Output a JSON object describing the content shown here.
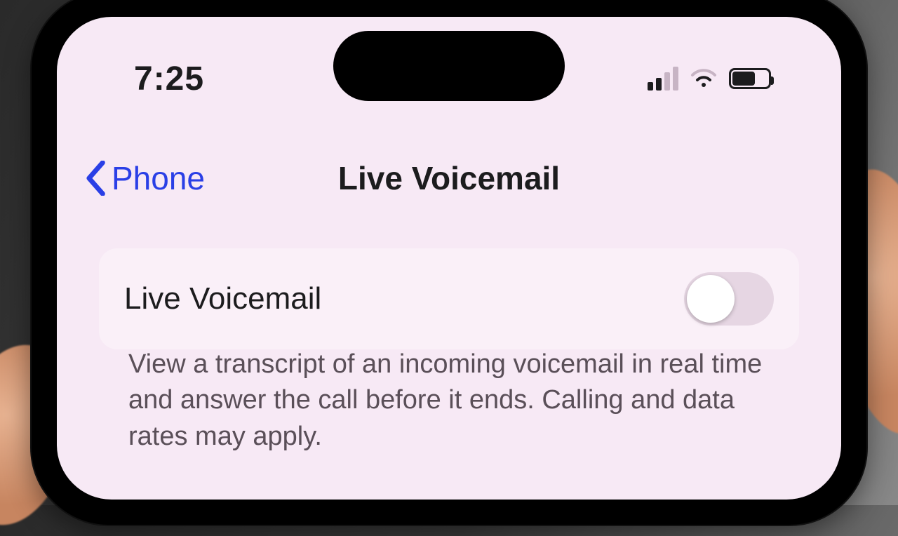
{
  "status": {
    "time": "7:25",
    "cell_bars_active": 2,
    "cell_bars_total": 4
  },
  "nav": {
    "back_label": "Phone",
    "title": "Live Voicemail"
  },
  "setting": {
    "label": "Live Voicemail",
    "enabled": false
  },
  "footer": {
    "text": "View a transcript of an incoming voicemail in real time and answer the call before it ends. Calling and data rates may apply."
  }
}
